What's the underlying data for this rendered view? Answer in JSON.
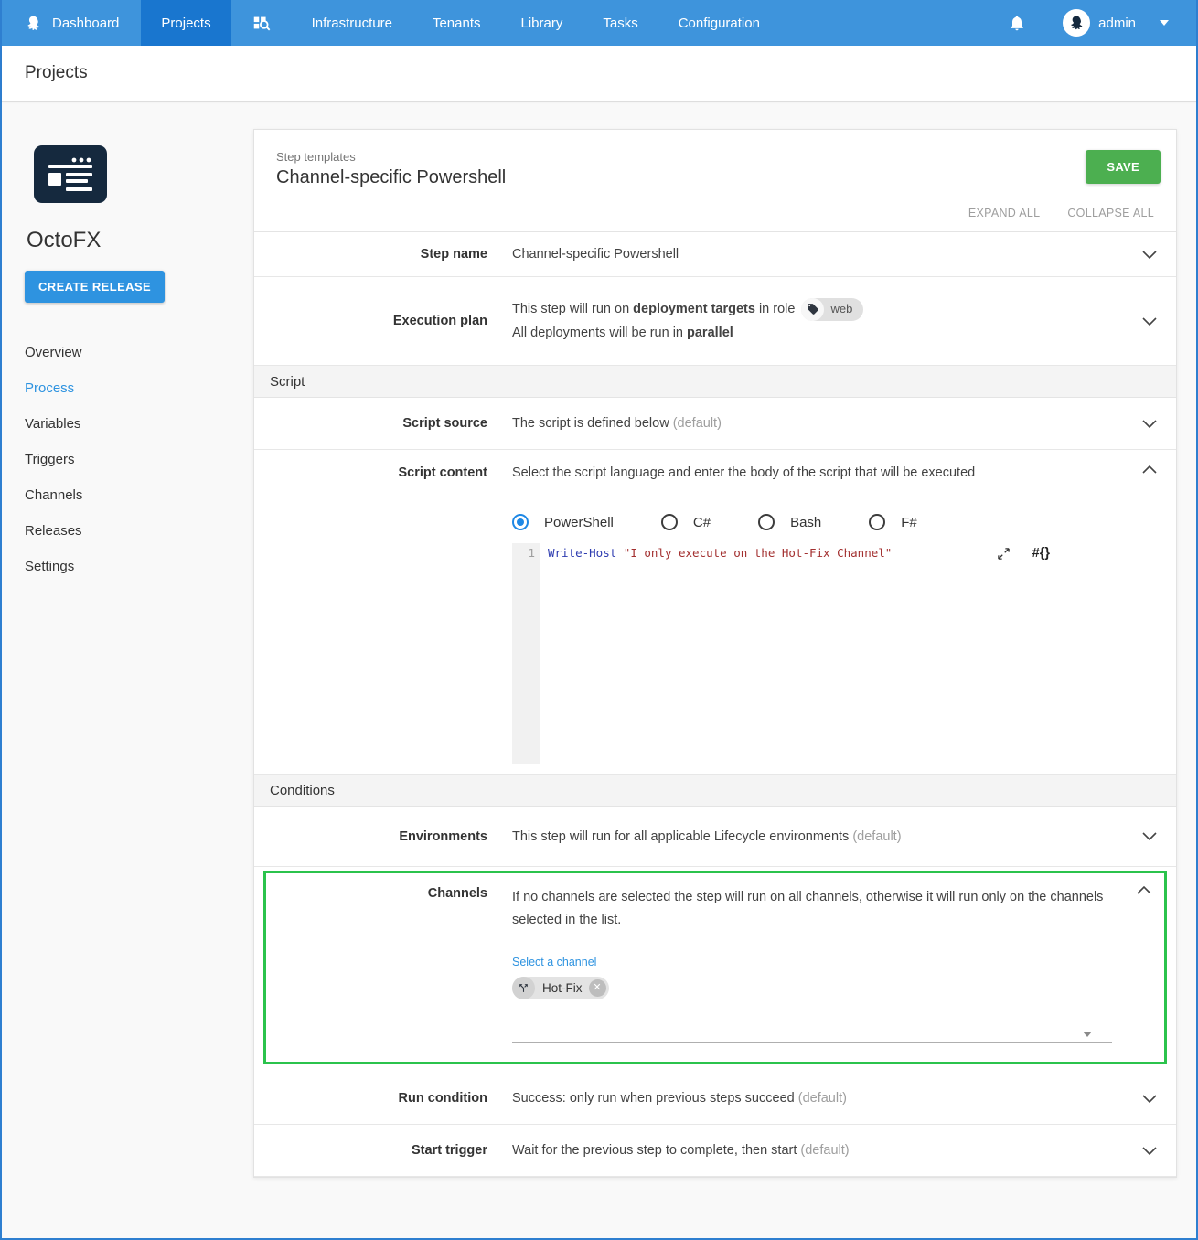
{
  "colors": {
    "nav_blue": "#3e94dc",
    "nav_active_blue": "#1976cf",
    "accent_blue": "#2e93e0",
    "save_green": "#4caf50",
    "highlight_green": "#2bc34c",
    "code_keyword": "#2e3cb0",
    "code_string": "#a33030",
    "logo_navy": "#15293e"
  },
  "topnav": {
    "tabs": [
      {
        "label": "Dashboard"
      },
      {
        "label": "Projects"
      },
      {
        "label": "Infrastructure"
      },
      {
        "label": "Tenants"
      },
      {
        "label": "Library"
      },
      {
        "label": "Tasks"
      },
      {
        "label": "Configuration"
      }
    ],
    "active_tab": "Projects",
    "user": "admin"
  },
  "titlebar": {
    "title": "Projects"
  },
  "sidebar": {
    "project_name": "OctoFX",
    "create_release": "CREATE RELEASE",
    "items": [
      {
        "label": "Overview"
      },
      {
        "label": "Process"
      },
      {
        "label": "Variables"
      },
      {
        "label": "Triggers"
      },
      {
        "label": "Channels"
      },
      {
        "label": "Releases"
      },
      {
        "label": "Settings"
      }
    ],
    "active_item": "Process"
  },
  "card": {
    "eyebrow": "Step templates",
    "title": "Channel-specific Powershell",
    "save": "SAVE",
    "expand_all": "EXPAND ALL",
    "collapse_all": "COLLAPSE ALL",
    "step_name": {
      "label": "Step name",
      "value": "Channel-specific Powershell"
    },
    "execution_plan": {
      "label": "Execution plan",
      "line1_prefix": "This step will run on ",
      "line1_bold": "deployment targets",
      "line1_suffix": " in role",
      "role_tag": "web",
      "line2_prefix": "All deployments will be run in ",
      "line2_bold": "parallel"
    },
    "script_section": "Script",
    "script_source": {
      "label": "Script source",
      "value": "The script is defined below ",
      "default_suffix": "(default)"
    },
    "script_content": {
      "label": "Script content",
      "description": "Select the script language and enter the body of the script that will be executed",
      "languages": [
        {
          "label": "PowerShell"
        },
        {
          "label": "C#"
        },
        {
          "label": "Bash"
        },
        {
          "label": "F#"
        }
      ],
      "selected_language": "PowerShell",
      "line_number": "1",
      "code_cmdlet": "Write-Host",
      "code_string": "\"I only execute on the Hot-Fix Channel\"",
      "insert_variable_icon": "#{}"
    },
    "conditions_section": "Conditions",
    "environments": {
      "label": "Environments",
      "value": "This step will run for all applicable Lifecycle environments ",
      "default_suffix": "(default)"
    },
    "channels": {
      "label": "Channels",
      "description": "If no channels are selected the step will run on all channels, otherwise it will run only on the channels selected in the list.",
      "select_label": "Select a channel",
      "chip": "Hot-Fix"
    },
    "run_condition": {
      "label": "Run condition",
      "value": "Success: only run when previous steps succeed ",
      "default_suffix": "(default)"
    },
    "start_trigger": {
      "label": "Start trigger",
      "value": "Wait for the previous step to complete, then start ",
      "default_suffix": "(default)"
    }
  }
}
